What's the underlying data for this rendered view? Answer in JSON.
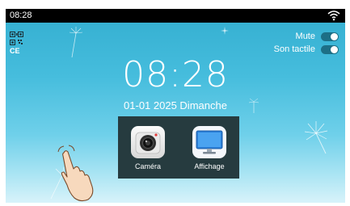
{
  "status_bar": {
    "time": "08:28",
    "wifi_icon": "wifi-icon"
  },
  "top_left": {
    "qr_icon": "qr-code-icon",
    "label": "CE"
  },
  "toggles": [
    {
      "label": "Mute",
      "state": "on"
    },
    {
      "label": "Son tactile",
      "state": "on"
    }
  ],
  "clock": {
    "time": "08:28",
    "date": "01-01 2025 Dimanche"
  },
  "apps": [
    {
      "label": "Caméra",
      "icon": "camera-icon"
    },
    {
      "label": "Affichage",
      "icon": "monitor-icon"
    }
  ],
  "colors": {
    "sky_top": "#33aed0",
    "sky_bottom": "#d8f3fa",
    "panel": "#263b3f",
    "toggle_on": "#1d6f86",
    "monitor_blue": "#2a7fd9"
  },
  "decor": {
    "hand_icon": "tap-hand-icon"
  }
}
